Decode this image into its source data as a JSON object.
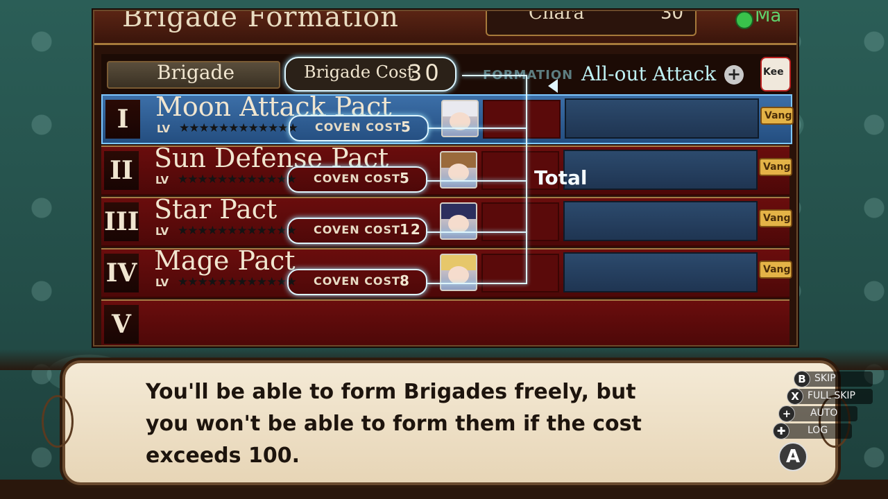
{
  "header": {
    "title": "Brigade Formation",
    "chara_label": "Chara",
    "chara_value": "30",
    "extra_label": "Ma"
  },
  "toolbar": {
    "brigade_tab": "Brigade",
    "brigade_cost_label": "Brigade Cost",
    "brigade_cost_value": "30",
    "formation_label": "FORMATION",
    "formation_value": "All-out Attack",
    "plus_label": "+",
    "keep_label": "Kee"
  },
  "rows": [
    {
      "roman": "I",
      "name": "Moon Attack Pact",
      "lv": "LV",
      "stars": "★★★★★★★★★★★★",
      "coven_label": "COVEN COST",
      "coven_value": "5",
      "vang": "Vang"
    },
    {
      "roman": "II",
      "name": "Sun Defense Pact",
      "lv": "LV",
      "stars": "★★★★★★★★★★★★",
      "coven_label": "COVEN COST",
      "coven_value": "5",
      "vang": "Vang"
    },
    {
      "roman": "III",
      "name": "Star Pact",
      "lv": "LV",
      "stars": "★★★★★★★★★★★★",
      "coven_label": "COVEN COST",
      "coven_value": "12",
      "vang": "Vang"
    },
    {
      "roman": "IV",
      "name": "Mage Pact",
      "lv": "LV",
      "stars": "★★★★★★★★★★★★",
      "coven_label": "COVEN COST",
      "coven_value": "8",
      "vang": "Vang"
    },
    {
      "roman": "V",
      "name": ""
    }
  ],
  "annotation": {
    "total_label": "Total"
  },
  "dialog": {
    "text": "You'll be able to form Brigades freely, but you won't be able to form them if the cost exceeds 100."
  },
  "controls": [
    {
      "key": "B",
      "label": "SKIP"
    },
    {
      "key": "X",
      "label": "FULL SKIP"
    },
    {
      "key": "+",
      "label": "AUTO"
    },
    {
      "key": "✚",
      "label": "LOG"
    }
  ],
  "advance_key": "A",
  "colors": {
    "highlight": "#dff6ff",
    "row_red": "#6a0d0d",
    "row_selected": "#3c6fa8"
  }
}
